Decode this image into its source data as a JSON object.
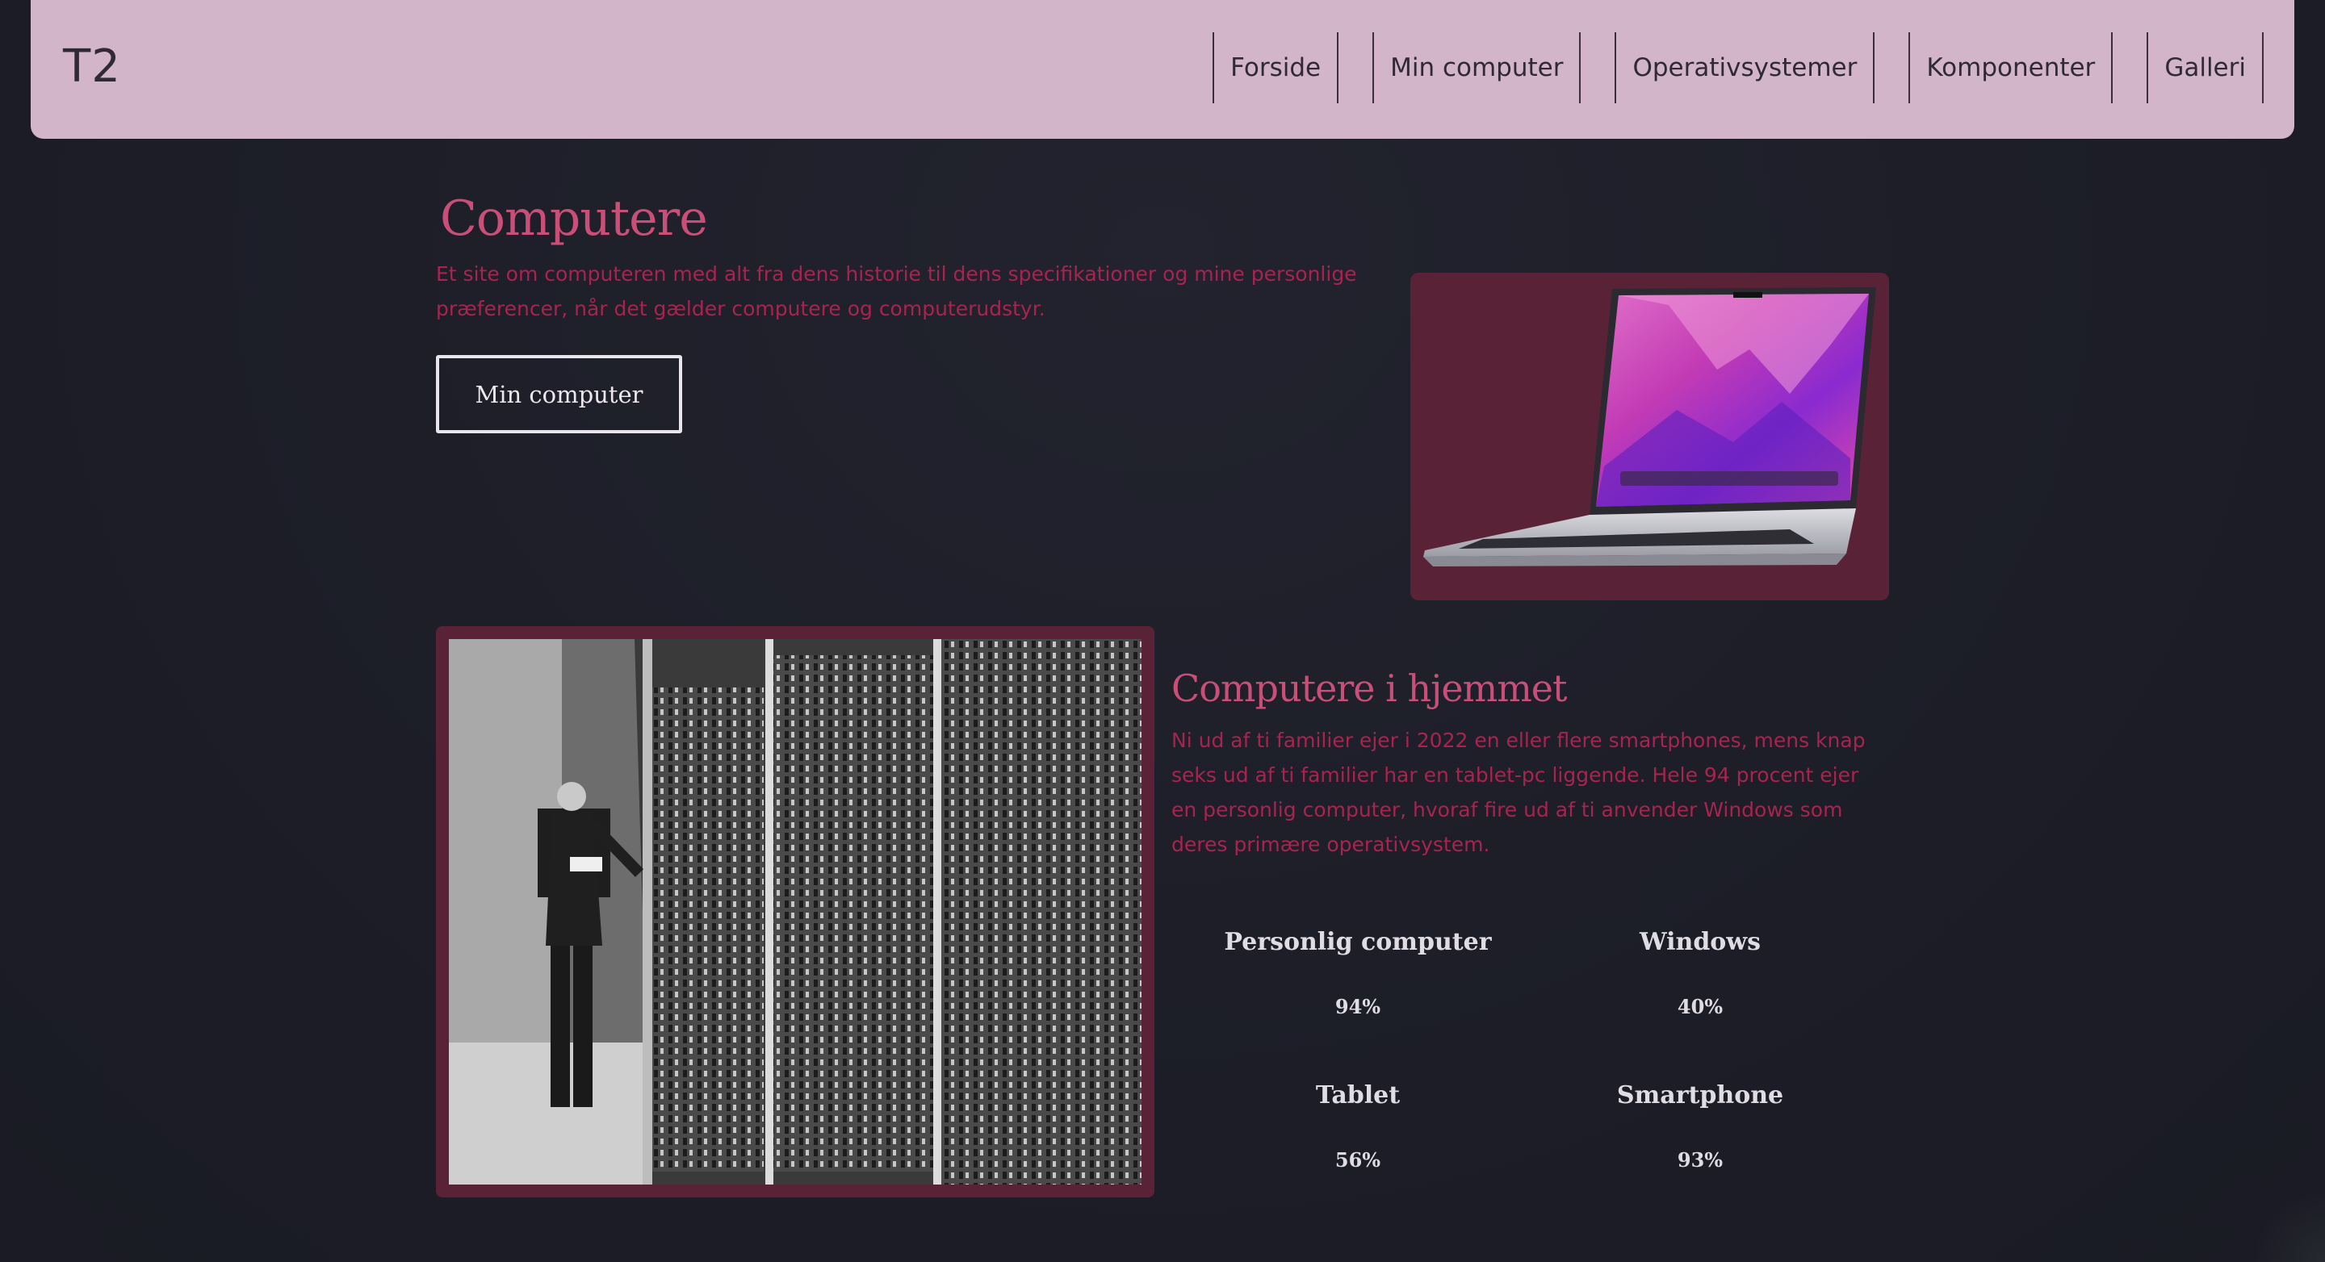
{
  "navbar": {
    "brand": "T2",
    "items": [
      {
        "label": "Forside"
      },
      {
        "label": "Min computer"
      },
      {
        "label": "Operativsystemer"
      },
      {
        "label": "Komponenter"
      },
      {
        "label": "Galleri"
      }
    ]
  },
  "hero": {
    "title": "Computere",
    "text": "Et site om computeren med alt fra dens historie til dens specifikationer og mine personlige præferencer, når det gælder computere og computerudstyr.",
    "button_label": "Min computer"
  },
  "home_section": {
    "title": "Computere i hjemmet",
    "text": "Ni ud af ti familier ejer i 2022 en eller flere smartphones, mens knap seks ud af ti familier har en tablet-pc liggende. Hele 94 procent ejer en personlig computer, hvoraf fire ud af ti anvender Windows som deres primære operativsystem.",
    "stats": [
      {
        "label": "Personlig computer",
        "value": "94%"
      },
      {
        "label": "Windows",
        "value": "40%"
      },
      {
        "label": "Tablet",
        "value": "56%"
      },
      {
        "label": "Smartphone",
        "value": "93%"
      }
    ]
  },
  "colors": {
    "background": "#1c1d27",
    "navbar": "#d3b5c9",
    "accent": "#c94e78",
    "body_text": "#a8244f",
    "card": "#5a2236"
  }
}
